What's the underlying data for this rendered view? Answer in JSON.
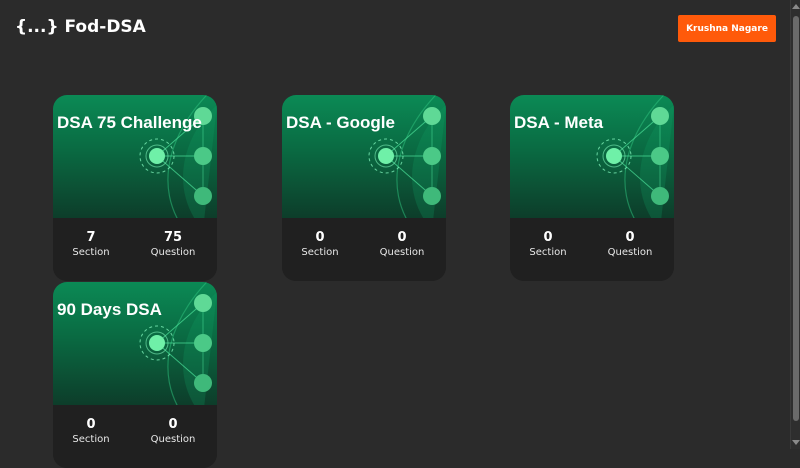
{
  "app": {
    "logo": "{...} Fod-DSA",
    "user_button_label": "Krushna Nagare"
  },
  "colors": {
    "background": "#2b2b2b",
    "accent": "#ff5a0a",
    "card_green": "#0b8a55",
    "card_footer": "#202020"
  },
  "cards": [
    {
      "title": "DSA 75 Challenge",
      "sections": "7",
      "section_label": "Section",
      "questions": "75",
      "question_label": "Question"
    },
    {
      "title": "DSA - Google",
      "sections": "0",
      "section_label": "Section",
      "questions": "0",
      "question_label": "Question"
    },
    {
      "title": "DSA - Meta",
      "sections": "0",
      "section_label": "Section",
      "questions": "0",
      "question_label": "Question"
    },
    {
      "title": "90 Days DSA",
      "sections": "0",
      "section_label": "Section",
      "questions": "0",
      "question_label": "Question"
    }
  ],
  "icons": {
    "card_art": "network-graph-icon"
  }
}
